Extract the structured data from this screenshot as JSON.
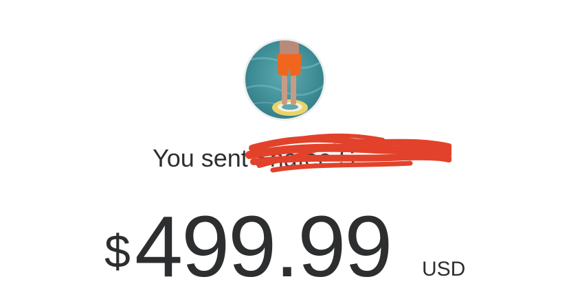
{
  "transaction": {
    "sent_prefix": "You sent",
    "recipient_name": "Shafee S",
    "currency_symbol": "$",
    "amount": "499.99",
    "currency_code": "USD"
  },
  "avatar": {
    "icon": "profile-photo-icon"
  },
  "colors": {
    "text": "#2c2e2f",
    "redaction": "#e2422b",
    "avatar_border": "#eceeef"
  }
}
